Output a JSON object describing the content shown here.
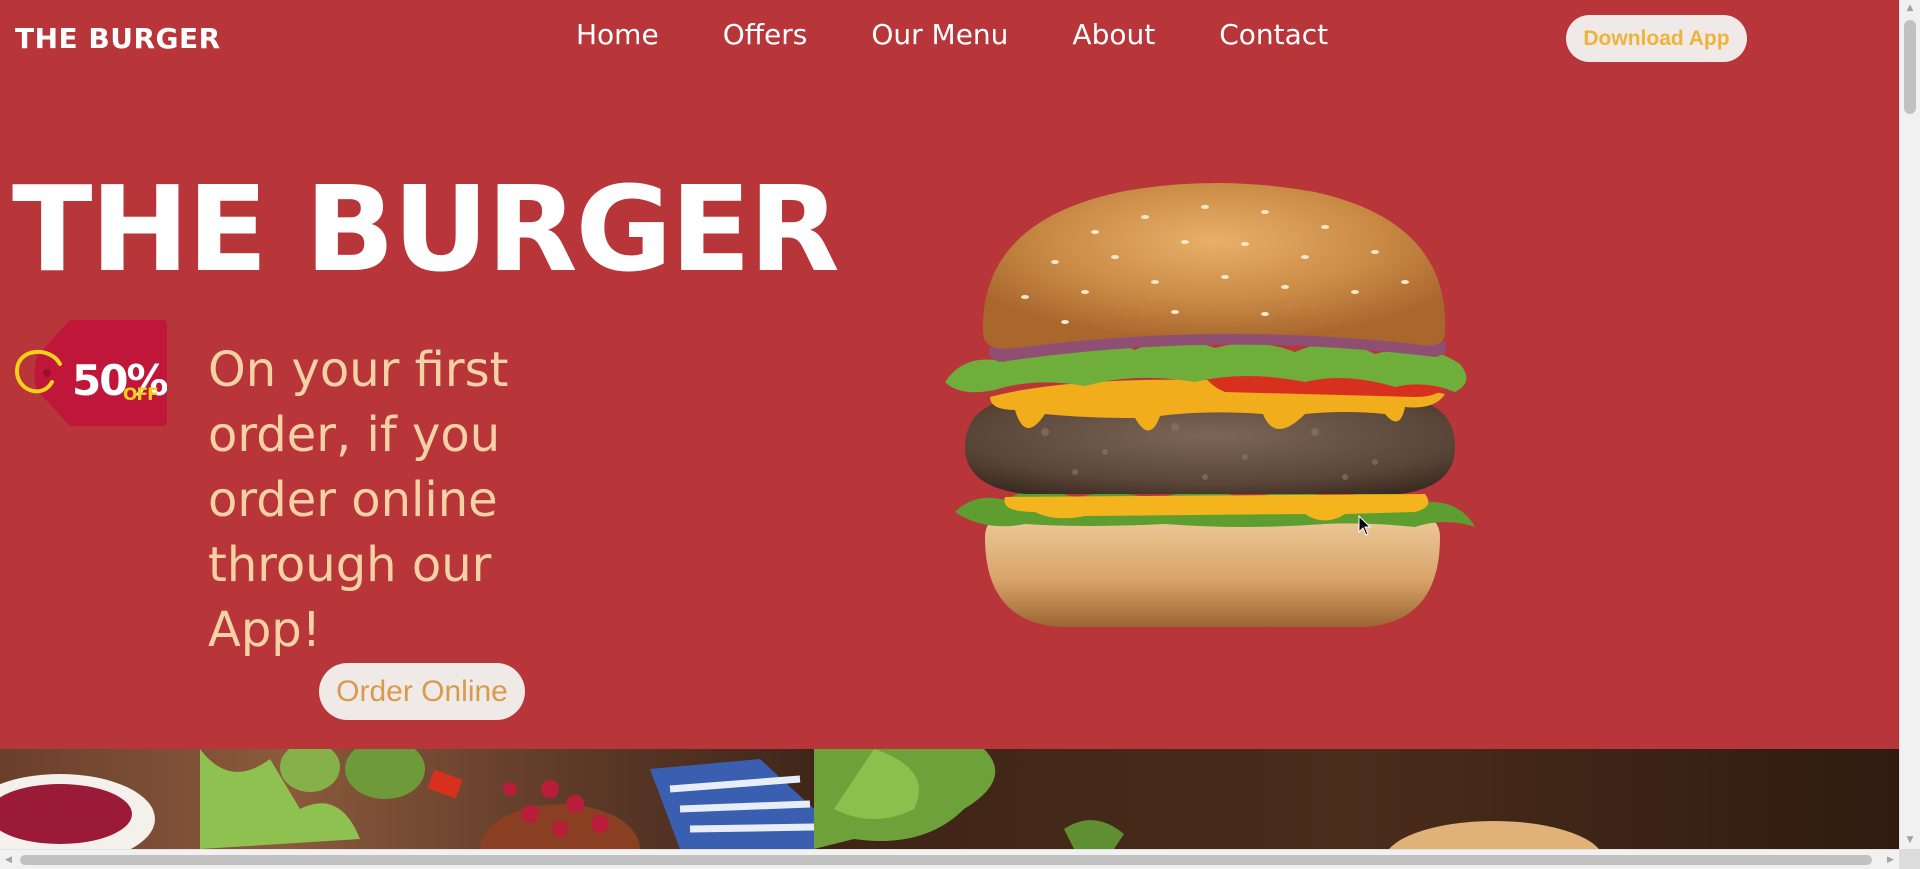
{
  "header": {
    "brand": "THE BURGER",
    "nav": [
      "Home",
      "Offers",
      "Our Menu",
      "About",
      "Contact"
    ],
    "download_label": "Download App"
  },
  "hero": {
    "title": "THE BURGER",
    "promo_tag": {
      "value": "50%",
      "suffix": "OFF"
    },
    "offer_text": "On your first order, if you order online through our App!",
    "order_label": "Order Online"
  },
  "colors": {
    "background": "#b83539",
    "offer_text": "#f5d1a6",
    "button_bg": "#efeae8",
    "download_text": "#efb23b",
    "order_text": "#d99a4b",
    "tag": "#c0163a"
  },
  "icons": {
    "cursor": "mouse-pointer-icon",
    "scroll_up": "chevron-up-icon",
    "scroll_down": "chevron-down-icon",
    "scroll_left": "chevron-left-icon",
    "scroll_right": "chevron-right-icon"
  }
}
